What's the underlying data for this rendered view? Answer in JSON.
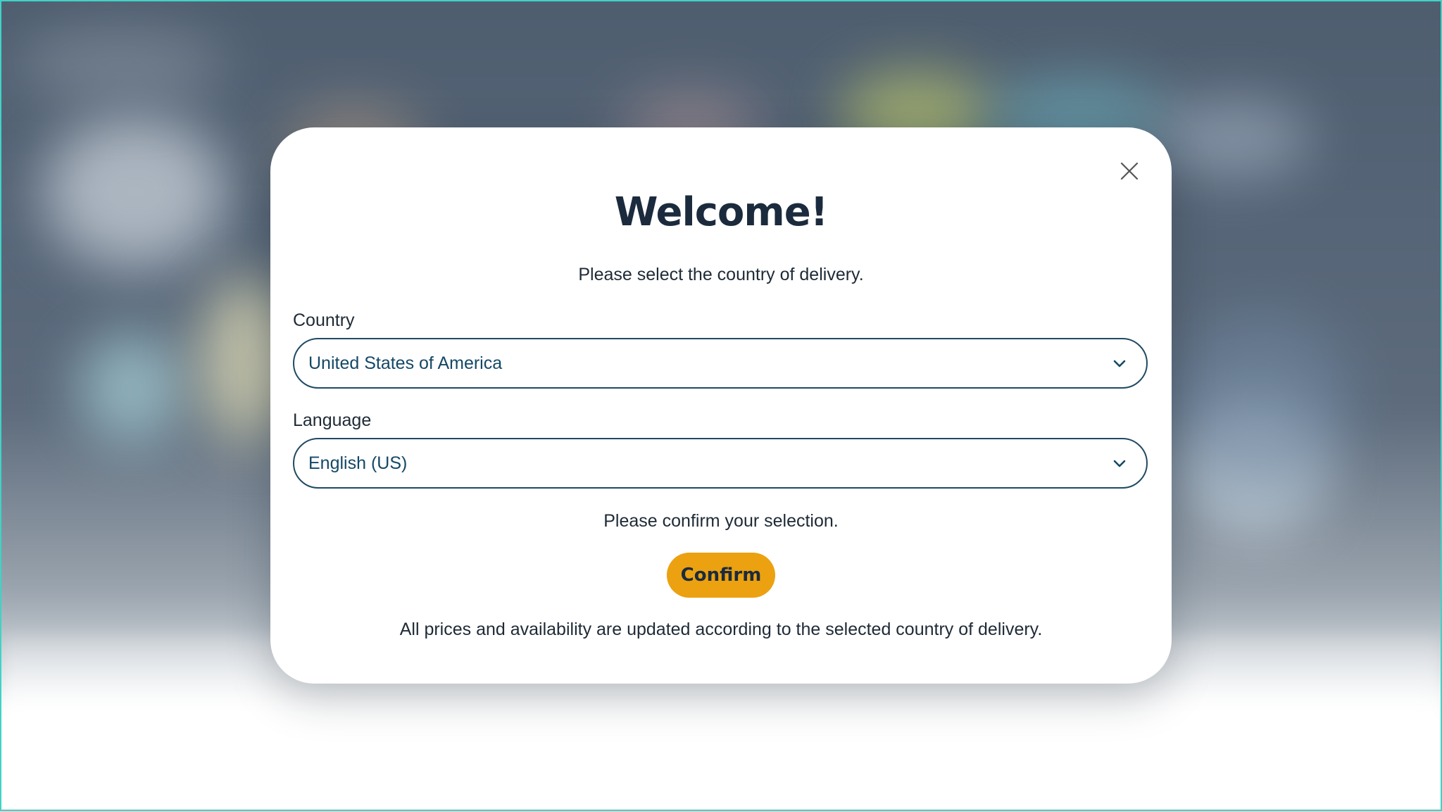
{
  "modal": {
    "title": "Welcome!",
    "subtitle": "Please select the country of delivery.",
    "close_icon": "close-icon",
    "country": {
      "label": "Country",
      "value": "United States of America",
      "icon": "chevron-down-icon"
    },
    "language": {
      "label": "Language",
      "value": "English (US)",
      "icon": "chevron-down-icon"
    },
    "confirm_prompt": "Please confirm your selection.",
    "confirm_label": "Confirm",
    "footnote": "All prices and availability are updated according to the selected country of delivery."
  },
  "colors": {
    "accent": "#eba110",
    "select_border": "#1f4a63",
    "select_text": "#144866",
    "title": "#1b2b3d"
  }
}
